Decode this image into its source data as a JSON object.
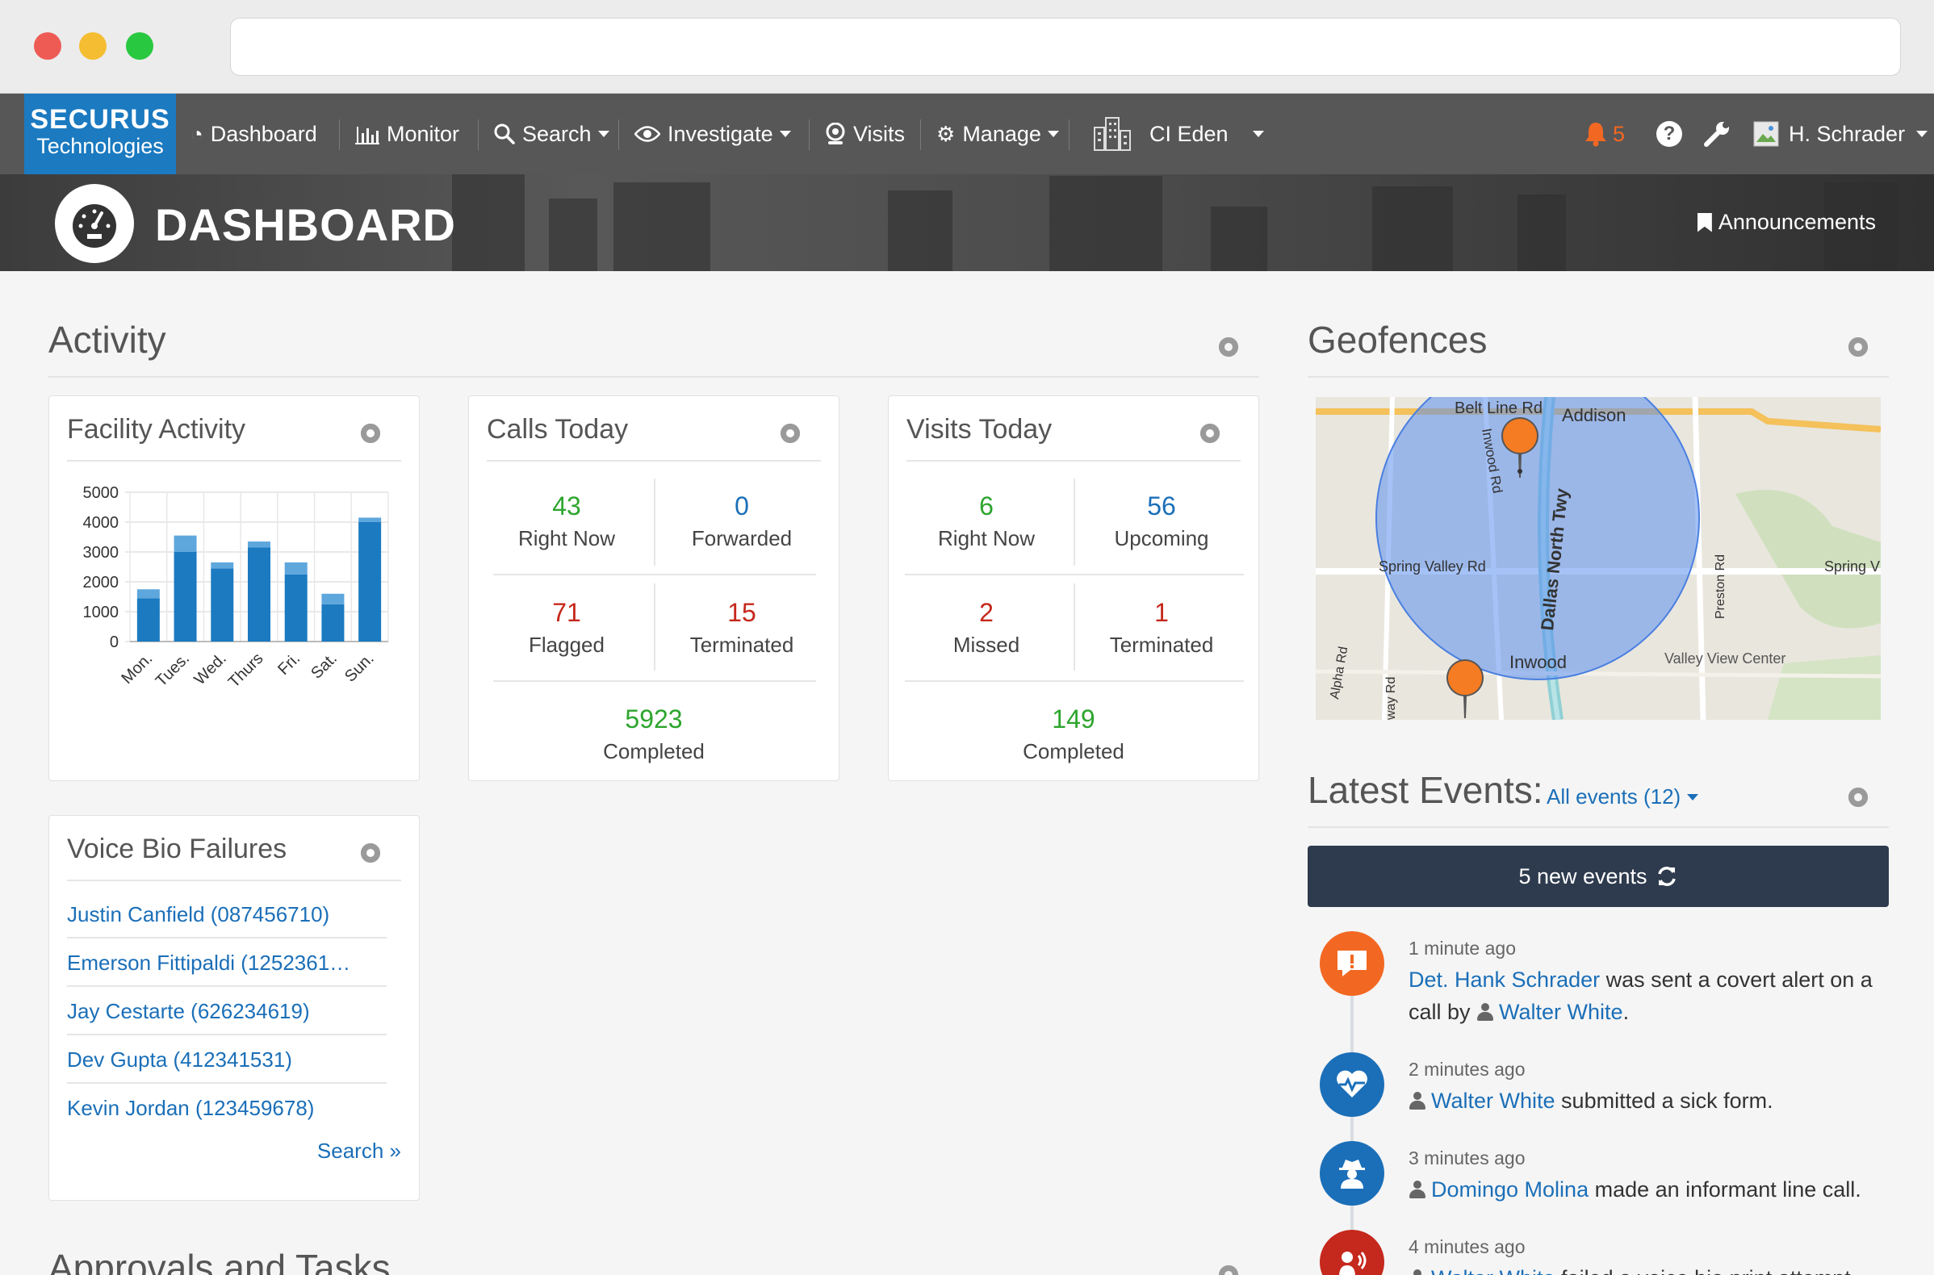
{
  "nav": {
    "logo_line1": "SECURUS",
    "logo_line2": "Technologies",
    "items": [
      {
        "label": "Dashboard",
        "icon": "speedometer-icon"
      },
      {
        "label": "Monitor",
        "icon": "bar-chart-icon"
      },
      {
        "label": "Search",
        "icon": "search-icon"
      },
      {
        "label": "Investigate",
        "icon": "eye-icon"
      },
      {
        "label": "Visits",
        "icon": "webcam-icon"
      },
      {
        "label": "Manage",
        "icon": "gear-icon"
      }
    ],
    "facility": "CI Eden",
    "alert_count": "5",
    "user": "H. Schrader"
  },
  "banner": {
    "title": "DASHBOARD",
    "announcements": "Announcements"
  },
  "activity": {
    "title": "Activity",
    "facility_activity": {
      "title": "Facility Activity"
    },
    "calls_today": {
      "title": "Calls Today",
      "right_now": {
        "value": "43",
        "label": "Right Now"
      },
      "forwarded": {
        "value": "0",
        "label": "Forwarded"
      },
      "flagged": {
        "value": "71",
        "label": "Flagged"
      },
      "terminated": {
        "value": "15",
        "label": "Terminated"
      },
      "completed": {
        "value": "5923",
        "label": "Completed"
      }
    },
    "visits_today": {
      "title": "Visits Today",
      "right_now": {
        "value": "6",
        "label": "Right Now"
      },
      "upcoming": {
        "value": "56",
        "label": "Upcoming"
      },
      "missed": {
        "value": "2",
        "label": "Missed"
      },
      "terminated": {
        "value": "1",
        "label": "Terminated"
      },
      "completed": {
        "value": "149",
        "label": "Completed"
      }
    }
  },
  "voice_bio": {
    "title": "Voice Bio Failures",
    "items": [
      "Justin Canfield (087456710)",
      "Emerson Fittipaldi (1252361…",
      "Jay Cestarte (626234619)",
      "Dev Gupta (412341531)",
      "Kevin Jordan (123459678)"
    ],
    "search_link": "Search »"
  },
  "approvals": {
    "title": "Approvals and Tasks"
  },
  "geofences": {
    "title": "Geofences",
    "map_labels": {
      "belt_line": "Belt Line Rd",
      "addison": "Addison",
      "inwood_rd": "Inwood Rd",
      "dallas_north": "Dallas North Twy",
      "spring_valley": "Spring Valley Rd",
      "spring_v": "Spring V",
      "preston": "Preston Rd",
      "inwood": "Inwood",
      "valley_view": "Valley View Center",
      "alpha": "Alpha Rd",
      "way_rd": "way Rd"
    }
  },
  "events": {
    "title": "Latest Events:",
    "filter": "All events (12)",
    "new_events": "5 new events",
    "list": [
      {
        "time": "1 minute ago",
        "icon": "alert-bubble-icon",
        "color": "#f26822",
        "actor": "Det. Hank Schrader",
        "text": "was sent a covert alert on a call by",
        "target": "Walter White",
        "end": "."
      },
      {
        "time": "2 minutes ago",
        "icon": "heart-pulse-icon",
        "color": "#1b6fb8",
        "actor": "Walter White",
        "text": "submitted a sick form."
      },
      {
        "time": "3 minutes ago",
        "icon": "spy-icon",
        "color": "#1b6fb8",
        "actor": "Domingo Molina",
        "text": "made an informant line call."
      },
      {
        "time": "4 minutes ago",
        "icon": "voice-icon",
        "color": "#c5281c",
        "actor": "Walter White",
        "text": "failed a voice bio print attempt."
      }
    ]
  },
  "chart_data": {
    "type": "bar",
    "title": "Facility Activity",
    "categories": [
      "Mon.",
      "Tues.",
      "Wed.",
      "Thurs",
      "Fri.",
      "Sat.",
      "Sun."
    ],
    "series": [
      {
        "values": [
          1450,
          3000,
          2450,
          3150,
          2250,
          1250,
          4000
        ]
      },
      {
        "values": [
          300,
          550,
          200,
          200,
          400,
          350,
          150
        ]
      }
    ],
    "stacked": true,
    "yticks": [
      "5000",
      "4000",
      "3000",
      "2000",
      "1000",
      "0"
    ],
    "ylim": [
      0,
      5000
    ],
    "grid": true,
    "colors": [
      "#1b7ac0",
      "#5ea7dd"
    ]
  }
}
